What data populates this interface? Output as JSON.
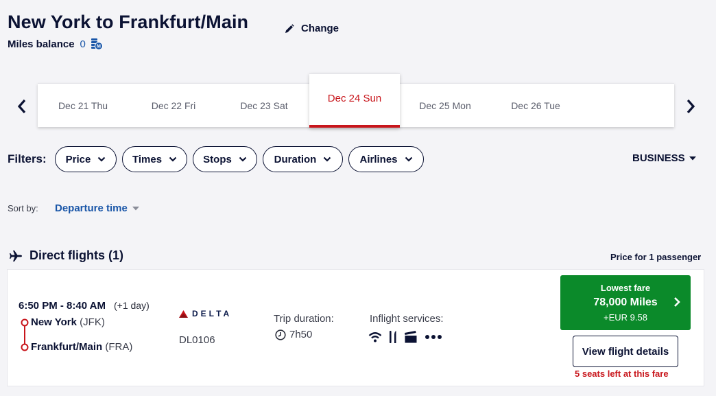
{
  "header": {
    "title": "New York to Frankfurt/Main",
    "change_label": "Change",
    "miles_label": "Miles balance",
    "miles_value": "0"
  },
  "dates": {
    "items": [
      {
        "label": "Dec 21 Thu",
        "active": false
      },
      {
        "label": "Dec 22 Fri",
        "active": false
      },
      {
        "label": "Dec 23 Sat",
        "active": false
      },
      {
        "label": "Dec 24 Sun",
        "active": true
      },
      {
        "label": "Dec 25 Mon",
        "active": false
      },
      {
        "label": "Dec 26 Tue",
        "active": false
      }
    ]
  },
  "filters": {
    "label": "Filters:",
    "items": [
      "Price",
      "Times",
      "Stops",
      "Duration",
      "Airlines"
    ],
    "cabin": "BUSINESS"
  },
  "sort": {
    "label": "Sort by:",
    "value": "Departure time"
  },
  "section": {
    "title": "Direct flights (1)",
    "price_for_prefix": "Price for ",
    "price_for_count": "1",
    "price_for_suffix": " passenger"
  },
  "flight": {
    "times": "6:50 PM - 8:40 AM",
    "day_offset": "(+1 day)",
    "origin_city": "New York",
    "origin_code": "(JFK)",
    "dest_city": "Frankfurt/Main",
    "dest_code": "(FRA)",
    "airline": "DELTA",
    "flight_number": "DL0106",
    "duration_label": "Trip duration:",
    "duration": "7h50",
    "services_label": "Inflight services:",
    "services": [
      "wifi-icon",
      "meal-icon",
      "entertainment-icon",
      "more-icon"
    ],
    "fare_label": "Lowest fare",
    "fare_amount": "78,000 Miles",
    "fare_tax": "+EUR 9.58",
    "details_label": "View flight details",
    "seats_count": "5",
    "seats_text": " seats left at this fare"
  },
  "colors": {
    "accent_red": "#c8151b",
    "fare_green": "#0b8a2a",
    "link_blue": "#1a56a8",
    "navy": "#0b1233"
  }
}
